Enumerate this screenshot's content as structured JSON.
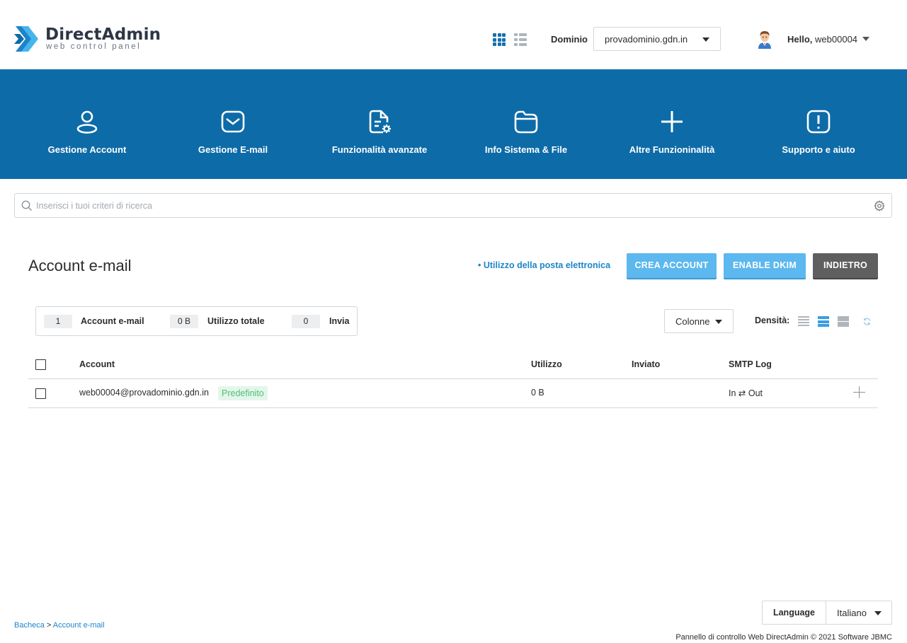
{
  "brand": {
    "name": "DirectAdmin",
    "tagline": "web control panel",
    "accent": "#0d6ba8"
  },
  "header": {
    "domain_label": "Dominio",
    "domain_value": "provadominio.gdn.in",
    "hello_label": "Hello,",
    "user": "web00004",
    "view_grid_icon": "grid-icon",
    "view_list_icon": "list-icon"
  },
  "nav": {
    "items": [
      {
        "label": "Gestione Account",
        "icon": "user-icon"
      },
      {
        "label": "Gestione E-mail",
        "icon": "envelope-icon"
      },
      {
        "label": "Funzionalità avanzate",
        "icon": "file-gear-icon"
      },
      {
        "label": "Info Sistema & File",
        "icon": "folder-icon"
      },
      {
        "label": "Altre Funzioninalità",
        "icon": "plus-icon"
      },
      {
        "label": "Supporto e aiuto",
        "icon": "alert-icon"
      }
    ]
  },
  "search": {
    "placeholder": "Inserisci i tuoi criteri di ricerca",
    "value": ""
  },
  "page": {
    "title": "Account e-mail",
    "usage_link": "• Utilizzo della posta elettronica",
    "buttons": {
      "create": "CREA ACCOUNT",
      "dkim": "ENABLE DKIM",
      "back": "INDIETRO"
    }
  },
  "stats": {
    "accounts_count": "1",
    "accounts_label": "Account e-mail",
    "usage_value": "0 B",
    "usage_label": "Utilizzo totale",
    "sent_value": "0",
    "sent_label": "Invia"
  },
  "toolbar": {
    "columns_label": "Colonne",
    "density_label": "Densità:"
  },
  "table": {
    "headers": {
      "account": "Account",
      "usage": "Utilizzo",
      "sent": "Inviato",
      "smtp": "SMTP Log"
    },
    "rows": [
      {
        "account": "web00004@provadominio.gdn.in",
        "tag": "Predefinito",
        "usage": "0 B",
        "sent": "",
        "smtp": "In ⇄ Out"
      }
    ]
  },
  "breadcrumb": {
    "home": "Bacheca",
    "separator": ">",
    "current": "Account e-mail"
  },
  "language": {
    "label": "Language",
    "value": "Italiano"
  },
  "footer": {
    "text": "Pannello di controllo Web DirectAdmin © 2021 Software JBMC"
  }
}
